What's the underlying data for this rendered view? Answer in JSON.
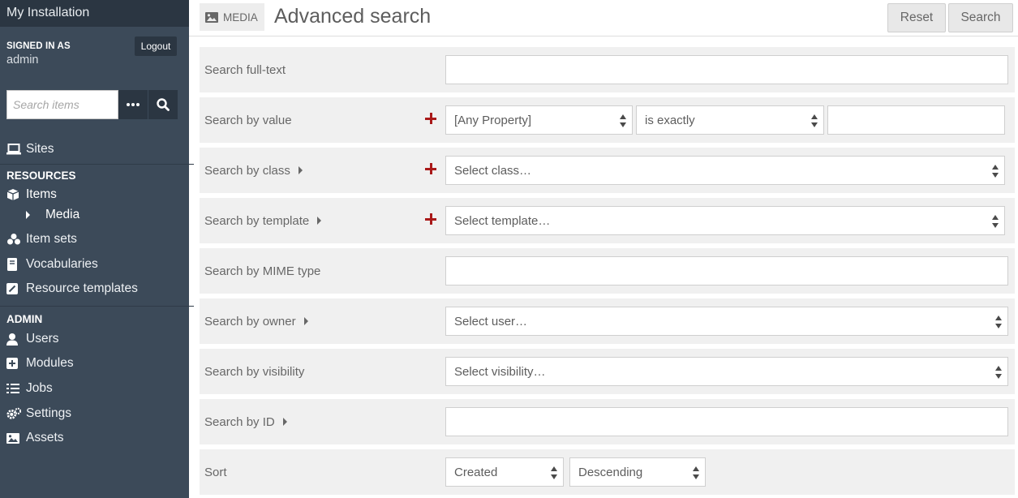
{
  "sidebar": {
    "install_title": "My Installation",
    "signed_in_label": "SIGNED IN AS",
    "user": "admin",
    "logout_label": "Logout",
    "search_placeholder": "Search items",
    "sites": "Sites",
    "resources_heading": "RESOURCES",
    "items": "Items",
    "media": "Media",
    "item_sets": "Item sets",
    "vocabularies": "Vocabularies",
    "resource_templates": "Resource templates",
    "admin_heading": "ADMIN",
    "users": "Users",
    "modules": "Modules",
    "jobs": "Jobs",
    "settings": "Settings",
    "assets": "Assets"
  },
  "header": {
    "badge": "MEDIA",
    "title": "Advanced search",
    "reset_label": "Reset",
    "search_label": "Search"
  },
  "form": {
    "fulltext_label": "Search full-text",
    "value_label": "Search by value",
    "value_property": "[Any Property]",
    "value_operator": "is exactly",
    "class_label": "Search by class",
    "class_placeholder": "Select class…",
    "template_label": "Search by template",
    "template_placeholder": "Select template…",
    "mime_label": "Search by MIME type",
    "owner_label": "Search by owner",
    "owner_placeholder": "Select user…",
    "visibility_label": "Search by visibility",
    "visibility_placeholder": "Select visibility…",
    "id_label": "Search by ID",
    "sort_label": "Sort",
    "sort_by": "Created",
    "sort_order": "Descending"
  },
  "colors": {
    "sidebar_bg": "#3c4a59",
    "sidebar_dark": "#2b3642",
    "plus_red": "#a91919"
  }
}
